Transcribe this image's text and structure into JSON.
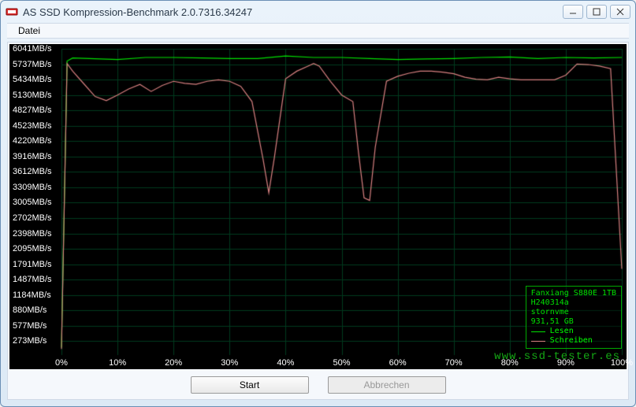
{
  "window": {
    "title": "AS SSD Kompression-Benchmark 2.0.7316.34247"
  },
  "menu": {
    "file": "Datei"
  },
  "buttons": {
    "start": "Start",
    "abort": "Abbrechen"
  },
  "legend": {
    "device": "Fanxiang S880E 1TB",
    "firmware": "H240314a",
    "driver": "stornvme",
    "capacity": "931,51 GB",
    "read_label": "Lesen",
    "write_label": "Schreiben",
    "read_color": "#00e000",
    "write_color": "#d88080"
  },
  "watermark": "www.ssd-tester.es",
  "chart_data": {
    "type": "line",
    "xlabel": "",
    "ylabel": "",
    "x_unit": "%",
    "y_unit": "MB/s",
    "xlim": [
      0,
      100
    ],
    "ylim": [
      0,
      6041
    ],
    "y_ticks": [
      273,
      577,
      880,
      1184,
      1487,
      1791,
      2095,
      2398,
      2702,
      3005,
      3309,
      3612,
      3916,
      4220,
      4523,
      4827,
      5130,
      5434,
      5737,
      6041
    ],
    "x_ticks": [
      0,
      10,
      20,
      30,
      40,
      50,
      60,
      70,
      80,
      90,
      100
    ],
    "series": [
      {
        "name": "Lesen",
        "color": "#00e000",
        "x": [
          0,
          1,
          2,
          5,
          10,
          15,
          20,
          25,
          30,
          35,
          40,
          45,
          50,
          55,
          60,
          65,
          70,
          75,
          80,
          85,
          90,
          95,
          100
        ],
        "y": [
          150,
          5800,
          5860,
          5850,
          5830,
          5870,
          5870,
          5860,
          5850,
          5850,
          5900,
          5870,
          5870,
          5850,
          5830,
          5840,
          5850,
          5870,
          5880,
          5850,
          5870,
          5860,
          5870
        ]
      },
      {
        "name": "Schreiben",
        "color": "#d88080",
        "x": [
          0,
          1,
          2,
          4,
          6,
          8,
          10,
          12,
          14,
          16,
          18,
          20,
          22,
          24,
          26,
          28,
          30,
          32,
          34,
          36,
          37,
          38,
          40,
          42,
          44,
          45,
          46,
          48,
          50,
          52,
          53,
          54,
          55,
          56,
          58,
          60,
          62,
          64,
          66,
          68,
          70,
          72,
          74,
          76,
          78,
          80,
          82,
          84,
          86,
          88,
          90,
          92,
          94,
          96,
          98,
          100
        ],
        "y": [
          120,
          5750,
          5600,
          5350,
          5100,
          5020,
          5130,
          5250,
          5340,
          5200,
          5320,
          5400,
          5360,
          5340,
          5400,
          5430,
          5400,
          5300,
          5000,
          3850,
          3200,
          3900,
          5450,
          5600,
          5700,
          5750,
          5700,
          5400,
          5130,
          5000,
          4000,
          3100,
          3050,
          4100,
          5400,
          5500,
          5560,
          5600,
          5600,
          5580,
          5550,
          5480,
          5440,
          5430,
          5480,
          5450,
          5430,
          5430,
          5430,
          5430,
          5520,
          5740,
          5730,
          5700,
          5650,
          1700
        ]
      }
    ]
  }
}
